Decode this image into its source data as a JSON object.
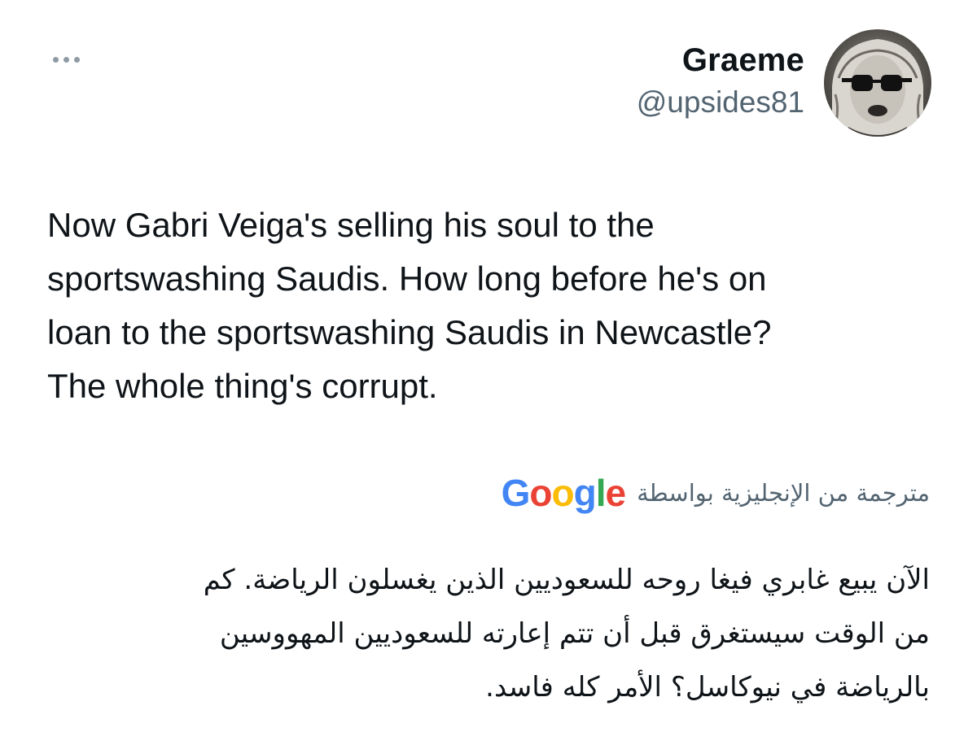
{
  "tweet": {
    "author": {
      "display_name": "Graeme",
      "handle": "@upsides81",
      "avatar_icon": "avatar-photo"
    },
    "more_icon": "ellipsis-icon",
    "text": "Now Gabri Veiga's selling his soul to the\nsportswashing Saudis. How long before he's on\nloan to the sportswashing Saudis in Newcastle?\nThe whole thing's corrupt."
  },
  "translation": {
    "label": "مترجمة من الإنجليزية بواسطة",
    "provider": "Google",
    "provider_letters": [
      {
        "char": "G",
        "color": "#4285F4"
      },
      {
        "char": "o",
        "color": "#EA4335"
      },
      {
        "char": "o",
        "color": "#FBBC05"
      },
      {
        "char": "g",
        "color": "#4285F4"
      },
      {
        "char": "l",
        "color": "#34A853"
      },
      {
        "char": "e",
        "color": "#EA4335"
      }
    ],
    "text": "الآن يبيع غابري فيغا روحه للسعوديين الذين يغسلون الرياضة. كم\nمن الوقت سيستغرق قبل أن تتم إعارته للسعوديين المهووسين\nبالرياضة في نيوكاسل؟ الأمر كله فاسد."
  },
  "colors": {
    "text_primary": "#0f1419",
    "text_secondary": "#536471",
    "background": "#ffffff"
  }
}
